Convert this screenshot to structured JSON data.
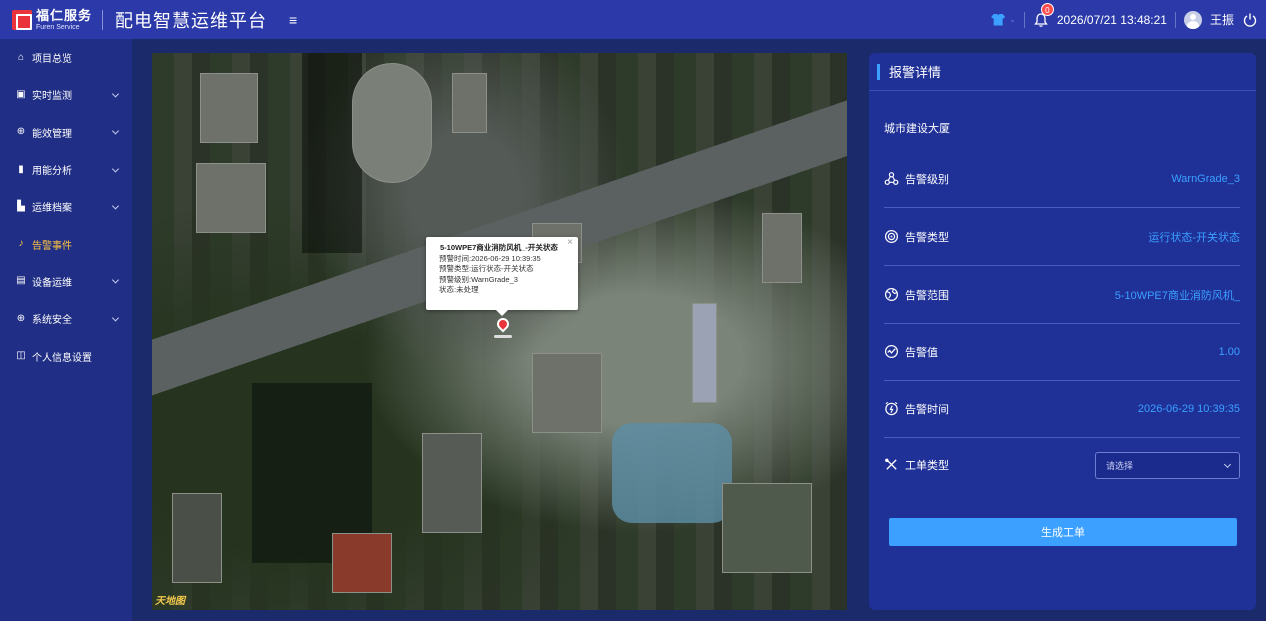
{
  "header": {
    "logo_cn": "福仁服务",
    "logo_en": "Furen Service",
    "app_title": "配电智慧运维平台",
    "notification_count": "0",
    "datetime": "2026/07/21 13:48:21",
    "username": "王振"
  },
  "sidebar": {
    "items": [
      {
        "label": "项目总览",
        "icon": "home-icon",
        "has_submenu": false
      },
      {
        "label": "实时监测",
        "icon": "monitor-icon",
        "has_submenu": true
      },
      {
        "label": "能效管理",
        "icon": "energy-icon",
        "has_submenu": true
      },
      {
        "label": "用能分析",
        "icon": "bar-chart-icon",
        "has_submenu": true
      },
      {
        "label": "运维档案",
        "icon": "archive-icon",
        "has_submenu": true
      },
      {
        "label": "告警事件",
        "icon": "bell-icon",
        "has_submenu": false,
        "active": true
      },
      {
        "label": "设备运维",
        "icon": "device-icon",
        "has_submenu": true
      },
      {
        "label": "系统安全",
        "icon": "security-icon",
        "has_submenu": true
      },
      {
        "label": "个人信息设置",
        "icon": "bookmark-icon",
        "has_submenu": false
      }
    ]
  },
  "map": {
    "credit": "天地图",
    "popup": {
      "title": "5-10WPE7商业消防风机_-开关状态",
      "lines": [
        "预警时间:2026-06-29 10:39:35",
        "预警类型:运行状态-开关状态",
        "预警级别:WarnGrade_3",
        "状态:未处理"
      ]
    }
  },
  "panel": {
    "title": "报警详情",
    "building": "城市建设大厦",
    "rows": [
      {
        "label": "告警级别",
        "value": "WarnGrade_3",
        "icon": "level-icon"
      },
      {
        "label": "告警类型",
        "value": "运行状态-开关状态",
        "icon": "target-icon"
      },
      {
        "label": "告警范围",
        "value": "5-10WPE7商业消防风机_",
        "icon": "globe-icon"
      },
      {
        "label": "告警值",
        "value": "1.00",
        "icon": "gauge-icon"
      },
      {
        "label": "告警时间",
        "value": "2026-06-29 10:39:35",
        "icon": "alarm-clock-icon"
      }
    ],
    "work_order_label": "工单类型",
    "work_order_placeholder": "请选择",
    "generate_button": "生成工单"
  },
  "colors": {
    "accent": "#3ba0ff",
    "header_bg": "#2b3aa8",
    "sidebar_bg": "#202f85",
    "active": "#ffc53d",
    "badge": "#ff4d4f"
  }
}
